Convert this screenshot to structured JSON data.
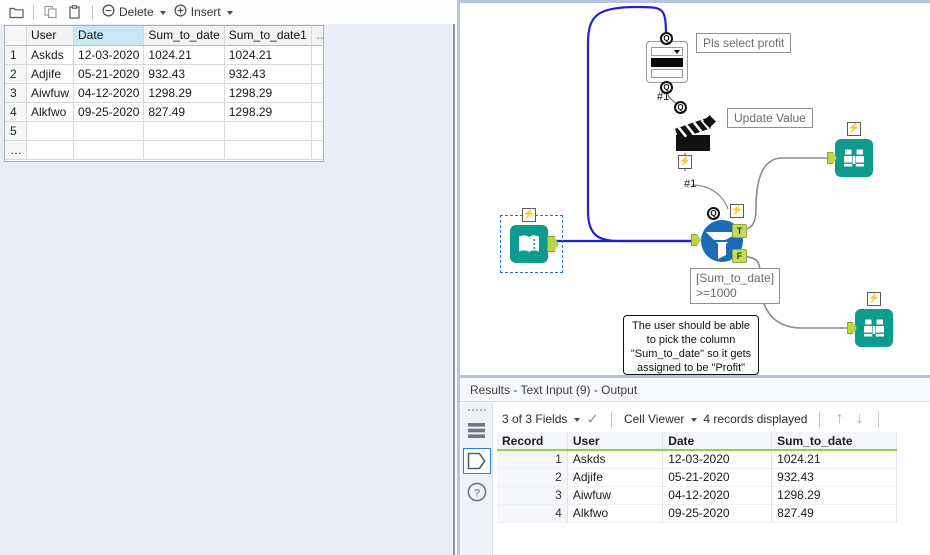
{
  "left_panel": {
    "toolbar": {
      "open_icon": "folder-icon",
      "copy_icon": "copy-icon",
      "paste_icon": "paste-icon",
      "delete_label": "Delete",
      "delete_icon": "minus-circle-icon",
      "insert_label": "Insert",
      "insert_icon": "plus-circle-icon"
    },
    "grid": {
      "columns": [
        "",
        "User",
        "Date",
        "Sum_to_date",
        "Sum_to_date1",
        "…"
      ],
      "selected_column": "Date",
      "rows": [
        {
          "num": "1",
          "user": "Askds",
          "date": "12-03-2020",
          "sum": "1024.21",
          "sum1": "1024.21"
        },
        {
          "num": "2",
          "user": "Adjife",
          "date": "05-21-2020",
          "sum": "932.43",
          "sum1": "932.43"
        },
        {
          "num": "3",
          "user": "Aiwfuw",
          "date": "04-12-2020",
          "sum": "1298.29",
          "sum1": "1298.29"
        },
        {
          "num": "4",
          "user": "Alkfwo",
          "date": "09-25-2020",
          "sum": "827.49",
          "sum1": "1298.29"
        },
        {
          "num": "5",
          "user": "",
          "date": "",
          "sum": "",
          "sum1": ""
        },
        {
          "num": "…",
          "user": "",
          "date": "",
          "sum": "",
          "sum1": ""
        }
      ]
    }
  },
  "canvas": {
    "tools": {
      "text_input": {
        "name": "Text Input",
        "icon": "book-icon",
        "selected": true
      },
      "dropdown": {
        "name": "Drop Down",
        "icon": "dropdown-interface-icon",
        "label": "Pls select profit",
        "anchor_number": "#1"
      },
      "action": {
        "name": "Action",
        "icon": "clapperboard-icon",
        "label": "Update Value",
        "anchor_number": "#1"
      },
      "filter": {
        "name": "Filter",
        "icon": "filter-funnel-icon",
        "true_label": "T",
        "false_label": "F",
        "expression_line1": "[Sum_to_date]",
        "expression_line2": ">=1000"
      },
      "browse_true": {
        "name": "Browse",
        "icon": "binoculars-icon"
      },
      "browse_false": {
        "name": "Browse",
        "icon": "binoculars-icon"
      }
    },
    "comment": {
      "line1": "The user should be able",
      "line2": "to pick the column",
      "line3": "\"Sum_to_date\" so it gets",
      "line4": "assigned to be \"Profit\""
    },
    "colors": {
      "tool_teal": "#0c9b8d",
      "filter_blue": "#1c6cb5",
      "anchor_green": "#b9d742",
      "interface_connection": "#1f1fd8",
      "data_connection": "#8a8a8a"
    }
  },
  "results": {
    "title": "Results - Text Input (9) - Output",
    "toolbar": {
      "fields_label": "3 of 3 Fields",
      "check_icon": "check-icon",
      "viewer_label": "Cell Viewer",
      "records_label": "4 records displayed",
      "up_icon": "arrow-up-icon",
      "down_icon": "arrow-down-icon"
    },
    "side_icons": [
      {
        "name": "data-view-icon"
      },
      {
        "name": "metadata-tag-icon",
        "selected": true
      },
      {
        "name": "help-icon"
      }
    ],
    "table": {
      "columns": [
        "Record",
        "User",
        "Date",
        "Sum_to_date"
      ],
      "rows": [
        {
          "record": "1",
          "user": "Askds",
          "date": "12-03-2020",
          "sum": "1024.21"
        },
        {
          "record": "2",
          "user": "Adjife",
          "date": "05-21-2020",
          "sum": "932.43"
        },
        {
          "record": "3",
          "user": "Aiwfuw",
          "date": "04-12-2020",
          "sum": "1298.29"
        },
        {
          "record": "4",
          "user": "Alkfwo",
          "date": "09-25-2020",
          "sum": "827.49"
        }
      ]
    }
  }
}
